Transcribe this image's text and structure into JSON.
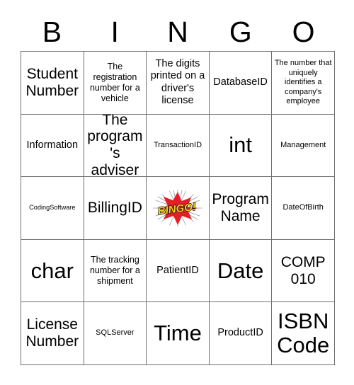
{
  "header": {
    "letters": [
      "B",
      "I",
      "N",
      "G",
      "O"
    ]
  },
  "grid": {
    "rows": 5,
    "columns": 5,
    "cells": [
      {
        "text": "Student Number",
        "size": "lg"
      },
      {
        "text": "The registration number for a vehicle",
        "size": "sm"
      },
      {
        "text": "The digits printed on a driver's license",
        "size": "md"
      },
      {
        "text": "DatabaseID",
        "size": "md"
      },
      {
        "text": "The number that uniquely identifies a company's employee",
        "size": "xs"
      },
      {
        "text": "Information",
        "size": "md"
      },
      {
        "text": "The program's adviser",
        "size": "lg"
      },
      {
        "text": "TransactionID",
        "size": "xs"
      },
      {
        "text": "int",
        "size": "xl"
      },
      {
        "text": "Management",
        "size": "xs"
      },
      {
        "text": "CodingSoftware",
        "size": "xxs"
      },
      {
        "text": "BillingID",
        "size": "lg"
      },
      {
        "text": "BINGO!",
        "size": "free"
      },
      {
        "text": "Program Name",
        "size": "lg"
      },
      {
        "text": "DateOfBirth",
        "size": "xs"
      },
      {
        "text": "char",
        "size": "xl"
      },
      {
        "text": "The tracking number for a shipment",
        "size": "sm"
      },
      {
        "text": "PatientID",
        "size": "md"
      },
      {
        "text": "Date",
        "size": "xl"
      },
      {
        "text": "COMP 010",
        "size": "lg"
      },
      {
        "text": "License Number",
        "size": "lg"
      },
      {
        "text": "SQLServer",
        "size": "xs"
      },
      {
        "text": "Time",
        "size": "xl"
      },
      {
        "text": "ProductID",
        "size": "md"
      },
      {
        "text": "ISBN Code",
        "size": "xl"
      }
    ]
  },
  "free_space": {
    "label": "BINGO!",
    "text_color": "#f5d020",
    "burst_color": "#e21f26",
    "outline_color": "#000000",
    "ray_color": "#9a9a9a"
  },
  "style": {
    "grid_line_color": "#6f6f6f",
    "background": "#ffffff",
    "text_color": "#000000"
  }
}
